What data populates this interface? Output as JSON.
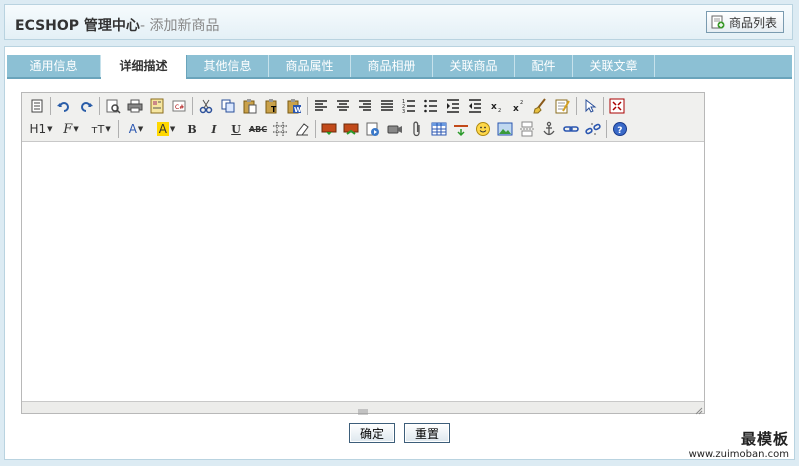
{
  "header": {
    "app_title": "ECSHOP 管理中心",
    "page_subtitle": "- 添加新商品",
    "list_button_label": "商品列表"
  },
  "tabs": [
    {
      "label": "通用信息",
      "active": false
    },
    {
      "label": "详细描述",
      "active": true
    },
    {
      "label": "其他信息",
      "active": false
    },
    {
      "label": "商品属性",
      "active": false
    },
    {
      "label": "商品相册",
      "active": false
    },
    {
      "label": "关联商品",
      "active": false
    },
    {
      "label": "配件",
      "active": false
    },
    {
      "label": "关联文章",
      "active": false
    }
  ],
  "editor": {
    "toolbar_row2": {
      "heading": "H1",
      "font_family": "F",
      "font_size": "тT",
      "font_color": "A",
      "highlight": "A",
      "bold": "B",
      "italic": "I",
      "underline": "U",
      "strike": "ABC"
    }
  },
  "actions": {
    "confirm_label": "确定",
    "reset_label": "重置"
  },
  "watermark": {
    "line1": "最模板",
    "line2": "www.zuimoban.com"
  }
}
